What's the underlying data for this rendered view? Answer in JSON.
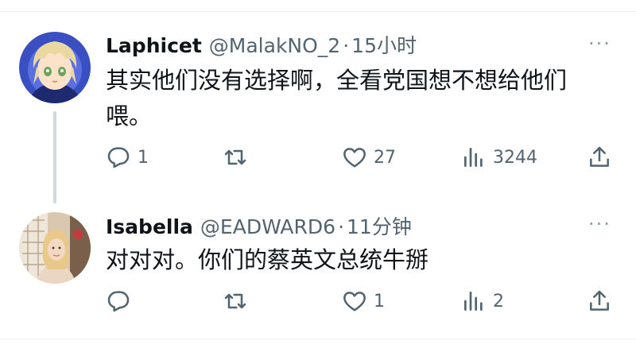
{
  "tweets": [
    {
      "display_name": "Laphicet",
      "handle": "@MalakNO_2",
      "separator": "·",
      "time": "15小时",
      "text": "其实他们没有选择啊，全看党国想不想给他们喂。",
      "more": "···",
      "actions": {
        "reply_count": "1",
        "retweet_count": "",
        "like_count": "27",
        "views_count": "3244"
      }
    },
    {
      "display_name": "Isabella",
      "handle": "@EADWARD6",
      "separator": "·",
      "time": "11分钟",
      "text": "对对对。你们的蔡英文总统牛掰",
      "more": "···",
      "actions": {
        "reply_count": "",
        "retweet_count": "",
        "like_count": "1",
        "views_count": "2"
      }
    }
  ],
  "colors": {
    "text_primary": "#0f1419",
    "text_secondary": "#536471",
    "thread_line": "#cfd9de",
    "divider": "#eff3f4"
  },
  "icons": [
    "reply-icon",
    "retweet-icon",
    "like-icon",
    "views-icon",
    "share-icon",
    "more-icon"
  ]
}
